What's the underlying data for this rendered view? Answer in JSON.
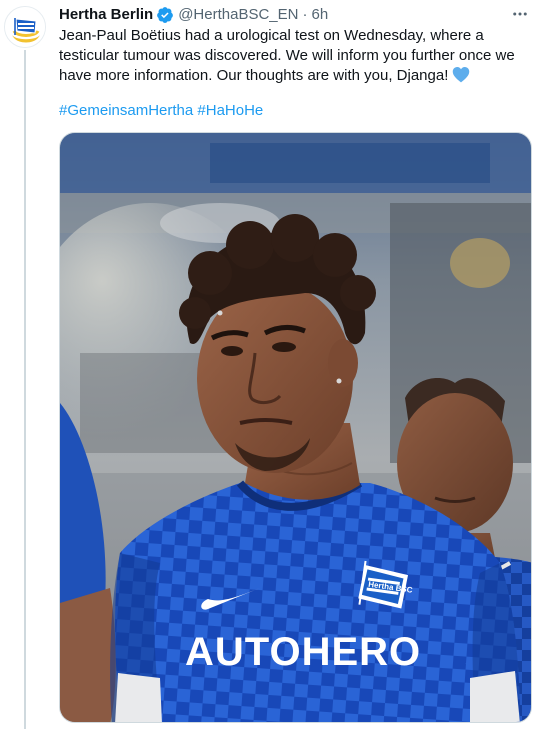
{
  "tweet": {
    "author_name": "Hertha Berlin",
    "handle": "@HerthaBSC_EN",
    "separator": "·",
    "time": "6h",
    "body_text": "Jean-Paul Boëtius had a urological test on Wednesday, where a testicular tumour was discovered. We will inform you further once we have more information. Our thoughts are with you, Djanga!",
    "hashtags": [
      "#GemeinsamHertha",
      "#HaHoHe"
    ],
    "icons": {
      "verified": "verified-badge-icon",
      "more": "more-options-icon",
      "heart": "blue-heart-emoji"
    },
    "colors": {
      "accent": "#1d9bf0",
      "text": "#0f1419",
      "secondary": "#536471",
      "hertha_blue": "#1a5fc7"
    }
  },
  "media": {
    "jersey_sponsor": "AUTOHERO",
    "crest_text": "Hertha BSC"
  }
}
